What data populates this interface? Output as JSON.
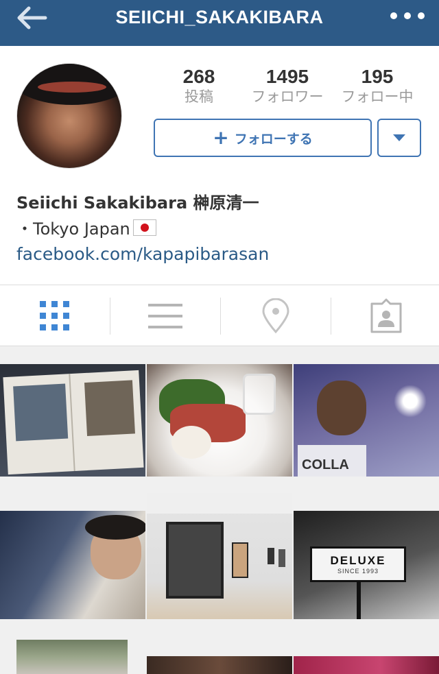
{
  "header": {
    "title": "SEIICHI_SAKAKIBARA",
    "back_icon": "back-arrow-icon",
    "more_icon": "more-dots-icon",
    "bg_color": "#2d5a87"
  },
  "profile": {
    "stats": [
      {
        "count": "268",
        "label": "投稿"
      },
      {
        "count": "1495",
        "label": "フォロワー"
      },
      {
        "count": "195",
        "label": "フォロー中"
      }
    ],
    "follow_button": {
      "plus": "+",
      "label": "フォローする"
    },
    "name": "Seiichi Sakakibara 榊原清一",
    "bio": "・Tokyo Japan",
    "link": "facebook.com/kapapibarasan",
    "accent_color": "#3f74b3"
  },
  "tabs": [
    {
      "icon": "grid-icon",
      "active": true
    },
    {
      "icon": "list-icon",
      "active": false
    },
    {
      "icon": "location-pin-icon",
      "active": false
    },
    {
      "icon": "tagged-person-icon",
      "active": false
    }
  ],
  "photos": [
    {
      "subject": "magazine-spread"
    },
    {
      "subject": "food-plate"
    },
    {
      "subject": "night-selfie",
      "caption": "COLLA"
    },
    {
      "subject": "clothing-rack-selfie"
    },
    {
      "subject": "gallery-wall"
    },
    {
      "subject": "deluxe-sign",
      "caption": "DELUXE",
      "subcaption": "SINCE 1993"
    },
    {
      "subject": "garden"
    },
    {
      "subject": "dark-photo"
    },
    {
      "subject": "pink-photo"
    }
  ]
}
